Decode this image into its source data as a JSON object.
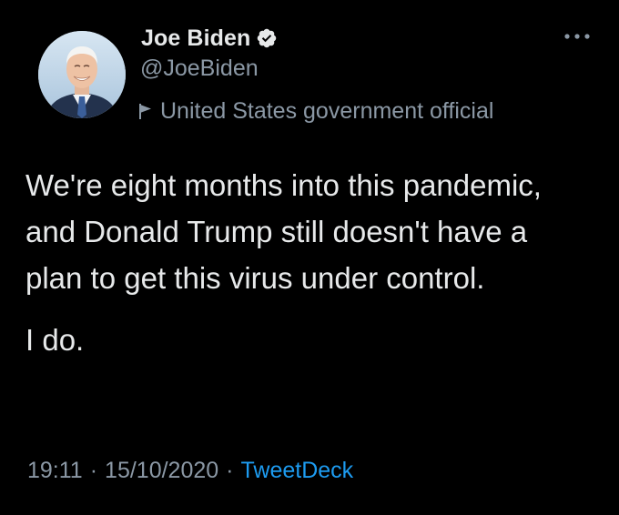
{
  "tweet": {
    "author": {
      "display_name": "Joe Biden",
      "handle": "@JoeBiden",
      "label": "United States government official",
      "verified": true
    },
    "body": {
      "paragraph_1": "We're eight months into this pandemic, and Donald Trump still doesn't have a plan to get this virus under control.",
      "paragraph_2": "I do."
    },
    "meta": {
      "time": "19:11",
      "separator": "·",
      "date": "15/10/2020",
      "source": "TweetDeck"
    }
  },
  "icons": {
    "verified": "verified-badge-icon",
    "flag": "flag-icon",
    "more": "more-options-icon"
  },
  "colors": {
    "background": "#000000",
    "primary_text": "#e7e9ea",
    "secondary_text": "#8b98a5",
    "link": "#1d9bf0"
  }
}
